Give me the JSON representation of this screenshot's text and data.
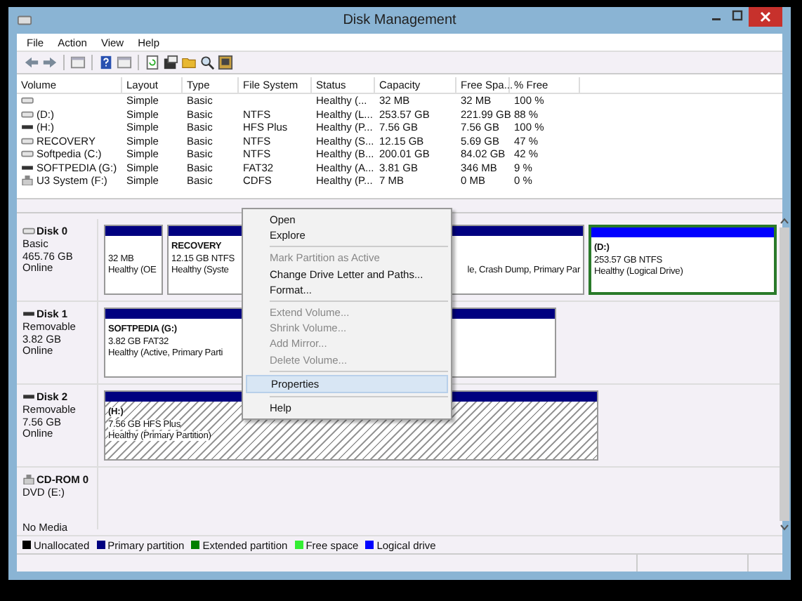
{
  "window": {
    "title": "Disk Management"
  },
  "menu_bar": [
    "File",
    "Action",
    "View",
    "Help"
  ],
  "volume_table": {
    "columns": [
      "Volume",
      "Layout",
      "Type",
      "File System",
      "Status",
      "Capacity",
      "Free Spa...",
      "% Free"
    ],
    "rows": [
      {
        "kind": "hdd",
        "cells": [
          "",
          "Simple",
          "Basic",
          "",
          "Healthy (...",
          "32 MB",
          "32 MB",
          "100 %"
        ]
      },
      {
        "kind": "hdd",
        "cells": [
          "(D:)",
          "Simple",
          "Basic",
          "NTFS",
          "Healthy (L...",
          "253.57 GB",
          "221.99 GB",
          "88 %"
        ]
      },
      {
        "kind": "usb",
        "cells": [
          "(H:)",
          "Simple",
          "Basic",
          "HFS Plus",
          "Healthy (P...",
          "7.56 GB",
          "7.56 GB",
          "100 %"
        ]
      },
      {
        "kind": "hdd",
        "cells": [
          "RECOVERY",
          "Simple",
          "Basic",
          "NTFS",
          "Healthy (S...",
          "12.15 GB",
          "5.69 GB",
          "47 %"
        ]
      },
      {
        "kind": "hdd",
        "cells": [
          "Softpedia (C:)",
          "Simple",
          "Basic",
          "NTFS",
          "Healthy (B...",
          "200.01 GB",
          "84.02 GB",
          "42 %"
        ]
      },
      {
        "kind": "usb",
        "cells": [
          "SOFTPEDIA (G:)",
          "Simple",
          "Basic",
          "FAT32",
          "Healthy (A...",
          "3.81 GB",
          "346 MB",
          "9 %"
        ]
      },
      {
        "kind": "cd",
        "cells": [
          "U3 System (F:)",
          "Simple",
          "Basic",
          "CDFS",
          "Healthy (P...",
          "7 MB",
          "0 MB",
          "0 %"
        ]
      }
    ]
  },
  "disks": [
    {
      "kind": "hdd",
      "name": "Disk 0",
      "info": {
        "type": "Basic",
        "size": "465.76 GB",
        "status": "Online"
      },
      "partitions": [
        {
          "kind": "primary",
          "selected": false,
          "size": "32 MB",
          "status": "Healthy (OE"
        },
        {
          "kind": "primary",
          "selected": false,
          "label": "RECOVERY",
          "size": "12.15 GB NTFS",
          "status": "Healthy (Syste"
        },
        {
          "kind": "primary",
          "selected": false,
          "status": "le, Crash Dump, Primary Par"
        },
        {
          "kind": "logical",
          "selected": false,
          "label": "(D:)",
          "size": "253.57 GB NTFS",
          "status": "Healthy (Logical Drive)"
        }
      ]
    },
    {
      "kind": "usb",
      "name": "Disk 1",
      "info": {
        "type": "Removable",
        "size": "3.82 GB",
        "status": "Online"
      },
      "partitions": [
        {
          "kind": "primary",
          "selected": false,
          "label": "SOFTPEDIA  (G:)",
          "size": "3.82 GB FAT32",
          "status": "Healthy (Active, Primary Parti"
        }
      ]
    },
    {
      "kind": "usb",
      "name": "Disk 2",
      "info": {
        "type": "Removable",
        "size": "7.56 GB",
        "status": "Online"
      },
      "partitions": [
        {
          "kind": "primary",
          "selected": true,
          "label": "(H:)",
          "size": "7.56 GB HFS Plus",
          "status": "Healthy (Primary Partition)"
        }
      ]
    },
    {
      "kind": "cd",
      "name": "CD-ROM 0",
      "info": {
        "type": "DVD (E:)",
        "status": "No Media"
      }
    }
  ],
  "legend": [
    {
      "label": "Unallocated",
      "color": "#000000"
    },
    {
      "label": "Primary partition",
      "color": "#000080"
    },
    {
      "label": "Extended partition",
      "color": "#008000"
    },
    {
      "label": "Free space",
      "color": "#33ee33"
    },
    {
      "label": "Logical drive",
      "color": "#0000ff"
    }
  ],
  "context_menu": [
    {
      "kind": "item",
      "label": "Open",
      "disabled": false,
      "selected": false
    },
    {
      "kind": "item",
      "label": "Explore",
      "disabled": false,
      "selected": false
    },
    {
      "kind": "separator"
    },
    {
      "kind": "item",
      "label": "Mark Partition as Active",
      "disabled": true,
      "selected": false
    },
    {
      "kind": "item",
      "label": "Change Drive Letter and Paths...",
      "disabled": false,
      "selected": false
    },
    {
      "kind": "item",
      "label": "Format...",
      "disabled": false,
      "selected": false
    },
    {
      "kind": "separator"
    },
    {
      "kind": "item",
      "label": "Extend Volume...",
      "disabled": true,
      "selected": false
    },
    {
      "kind": "item",
      "label": "Shrink Volume...",
      "disabled": true,
      "selected": false
    },
    {
      "kind": "item",
      "label": "Add Mirror...",
      "disabled": true,
      "selected": false
    },
    {
      "kind": "item",
      "label": "Delete Volume...",
      "disabled": true,
      "selected": false
    },
    {
      "kind": "separator"
    },
    {
      "kind": "item",
      "label": "Properties",
      "disabled": false,
      "selected": true
    },
    {
      "kind": "separator"
    },
    {
      "kind": "item",
      "label": "Help",
      "disabled": false,
      "selected": false
    }
  ]
}
